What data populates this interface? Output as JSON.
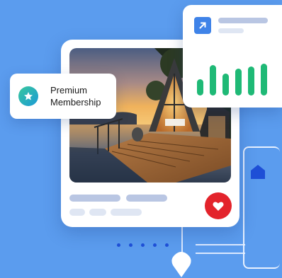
{
  "badge": {
    "line1": "Premium",
    "line2": "Membership",
    "icon": "star-icon",
    "gradient": [
      "#39c79c",
      "#1b9ad7"
    ]
  },
  "stats": {
    "icon": "arrow-up-right-icon",
    "bar_color": "#1fb976",
    "bar_levels": [
      0.5,
      0.95,
      0.7,
      0.85,
      0.9,
      1.0
    ]
  },
  "listing": {
    "image": "cabin-on-lake-photo",
    "favorite_icon": "heart-icon",
    "favorite_color": "#e3232b"
  },
  "decor": {
    "home_icon": "home-icon",
    "location_icon": "location-pin-icon",
    "dot_count": 5,
    "dot_color": "#1e4fd6"
  },
  "colors": {
    "background": "#5b9cee",
    "card": "#ffffff",
    "skeleton": "#b9c6e3",
    "skeleton_light": "#dfe6f3",
    "accent_blue": "#3f83e8"
  }
}
